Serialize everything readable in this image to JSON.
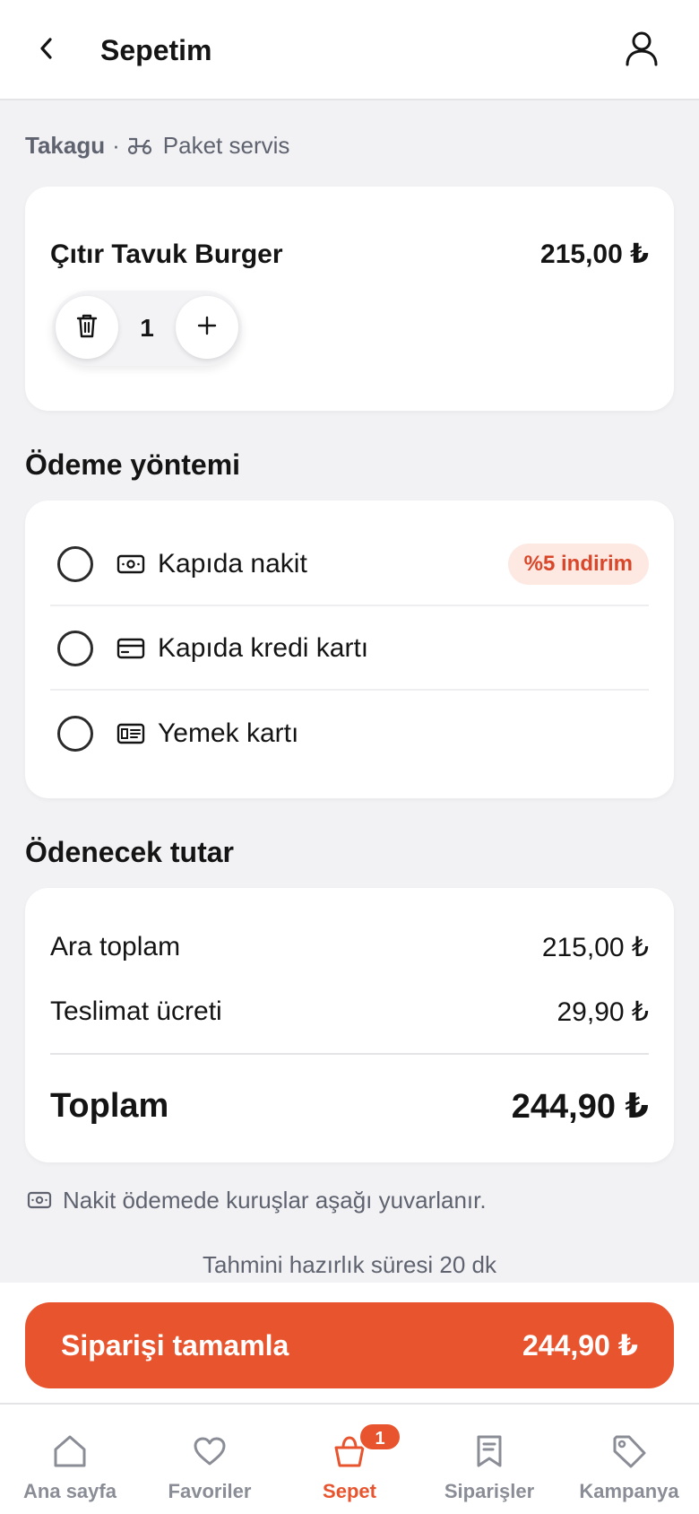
{
  "header": {
    "title": "Sepetim",
    "back_icon": "chevron-left-icon",
    "profile_icon": "user-icon"
  },
  "restaurant": {
    "name": "Takagu",
    "separator": "·",
    "delivery_icon": "scooter-icon",
    "delivery_type": "Paket servis"
  },
  "cart": {
    "items": [
      {
        "name": "Çıtır Tavuk Burger",
        "price": "215,00 ₺",
        "quantity": "1"
      }
    ]
  },
  "payment": {
    "title": "Ödeme yöntemi",
    "options": [
      {
        "label": "Kapıda nakit",
        "icon": "cash-icon",
        "badge": "%5 indirim",
        "selected": false
      },
      {
        "label": "Kapıda kredi kartı",
        "icon": "credit-card-icon",
        "selected": false
      },
      {
        "label": "Yemek kartı",
        "icon": "meal-card-icon",
        "selected": false
      }
    ]
  },
  "summary": {
    "title": "Ödenecek tutar",
    "subtotal_label": "Ara toplam",
    "subtotal_value": "215,00 ₺",
    "delivery_label": "Teslimat ücreti",
    "delivery_value": "29,90 ₺",
    "total_label": "Toplam",
    "total_value": "244,90 ₺"
  },
  "note": "Nakit ödemede kuruşlar aşağı yuvarlanır.",
  "prep_time": "Tahmini hazırlık süresi 20 dk",
  "order_button": {
    "label": "Siparişi tamamla",
    "amount": "244,90 ₺"
  },
  "nav": {
    "items": [
      {
        "label": "Ana sayfa",
        "icon": "home-icon",
        "active": false
      },
      {
        "label": "Favoriler",
        "icon": "heart-icon",
        "active": false
      },
      {
        "label": "Sepet",
        "icon": "basket-icon",
        "active": true,
        "badge": "1"
      },
      {
        "label": "Siparişler",
        "icon": "receipt-icon",
        "active": false
      },
      {
        "label": "Kampanya",
        "icon": "tag-icon",
        "active": false
      }
    ]
  },
  "colors": {
    "accent": "#e8542e",
    "badge_bg": "#fde8e2",
    "background": "#f2f2f4"
  }
}
